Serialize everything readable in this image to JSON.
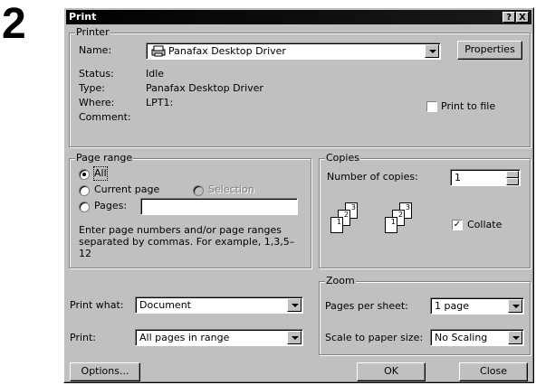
{
  "step_number": "2",
  "dialog": {
    "title": "Print",
    "help_btn": "?",
    "close_btn": "X"
  },
  "printer": {
    "group_title": "Printer",
    "name_label": "Name:",
    "name_value": "Panafax Desktop Driver",
    "properties_button": "Properties",
    "status_label": "Status:",
    "status_value": "Idle",
    "type_label": "Type:",
    "type_value": "Panafax Desktop Driver",
    "where_label": "Where:",
    "where_value": "LPT1:",
    "comment_label": "Comment:",
    "print_to_file_label": "Print to file",
    "print_to_file_checked": false
  },
  "page_range": {
    "group_title": "Page range",
    "all_label": "All",
    "current_label": "Current page",
    "selection_label": "Selection",
    "pages_label": "Pages:",
    "pages_value": "",
    "hint": "Enter page numbers and/or page ranges separated by commas.  For example, 1,3,5–12",
    "selected": "All"
  },
  "copies": {
    "group_title": "Copies",
    "number_label": "Number of copies:",
    "number_value": "1",
    "collate_label": "Collate",
    "collate_checked": true,
    "stack1": [
      "1",
      "2",
      "3"
    ],
    "stack2": [
      "1",
      "2",
      "3"
    ]
  },
  "print_what": {
    "label": "Print what:",
    "value": "Document"
  },
  "print": {
    "label": "Print:",
    "value": "All pages in range"
  },
  "zoom": {
    "group_title": "Zoom",
    "pages_per_sheet_label": "Pages per sheet:",
    "pages_per_sheet_value": "1 page",
    "scale_label": "Scale to paper size:",
    "scale_value": "No Scaling"
  },
  "buttons": {
    "options": "Options...",
    "ok": "OK",
    "close": "Close"
  }
}
